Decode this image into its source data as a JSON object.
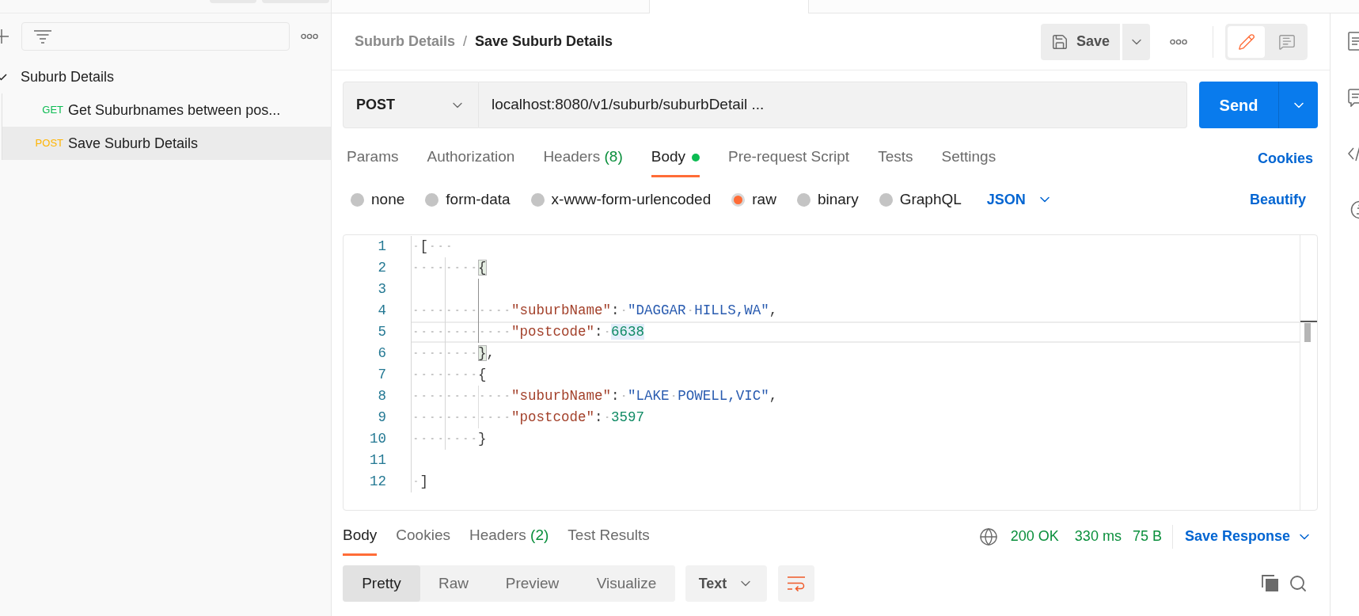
{
  "sidebar": {
    "collection": {
      "name": "Suburb Details",
      "expanded": true,
      "requests": [
        {
          "method": "GET",
          "color": "#0cbb52",
          "name": "Get Suburbnames between pos...",
          "selected": false
        },
        {
          "method": "POST",
          "color": "#ffb400",
          "name": "Save Suburb Details",
          "selected": true
        }
      ]
    }
  },
  "request_tabs": [
    {
      "selected": false
    },
    {
      "selected": false
    },
    {
      "selected": true
    },
    {
      "selected": false
    },
    {
      "selected": false
    },
    {
      "selected": false
    }
  ],
  "breadcrumb": {
    "parent": "Suburb Details",
    "separator": "/",
    "current": "Save Suburb Details"
  },
  "header_actions": {
    "save": "Save",
    "view_modes": [
      {
        "kind": "edit",
        "selected": true
      },
      {
        "kind": "comments",
        "selected": false
      }
    ]
  },
  "request": {
    "method": "POST",
    "url": "localhost:8080/v1/suburb/suburbDetail ...",
    "send": "Send"
  },
  "config_tabs": [
    {
      "label": "Params",
      "selected": false,
      "dot": false
    },
    {
      "label": "Authorization",
      "selected": false,
      "dot": false
    },
    {
      "label": "Headers",
      "count": "(8)",
      "selected": false,
      "dot": false
    },
    {
      "label": "Body",
      "selected": true,
      "dot": true
    },
    {
      "label": "Pre-request Script",
      "selected": false,
      "dot": false
    },
    {
      "label": "Tests",
      "selected": false,
      "dot": false
    },
    {
      "label": "Settings",
      "selected": false,
      "dot": false
    }
  ],
  "cookies": "Cookies",
  "body_types": [
    {
      "label": "none",
      "selected": false
    },
    {
      "label": "form-data",
      "selected": false
    },
    {
      "label": "x-www-form-urlencoded",
      "selected": false
    },
    {
      "label": "raw",
      "selected": true
    },
    {
      "label": "binary",
      "selected": false
    },
    {
      "label": "GraphQL",
      "selected": false
    }
  ],
  "body_format": "JSON",
  "beautify": "Beautify",
  "editor": {
    "lines": [
      {
        "number": "1",
        "current": false,
        "tokens": [
          {
            "kind": "plain",
            "text": " [   "
          }
        ]
      },
      {
        "number": "2",
        "current": false,
        "tokens": [
          {
            "kind": "bracket_match",
            "text": "        {"
          }
        ]
      },
      {
        "number": "3",
        "current": false
      },
      {
        "number": "4",
        "current": false,
        "tokens": [
          {
            "kind": "key",
            "text": "            \"suburbName\""
          },
          {
            "kind": "plain",
            "text": ": "
          },
          {
            "kind": "string",
            "text": "\"DAGGAR HILLS,WA\""
          },
          {
            "kind": "plain",
            "text": ","
          }
        ]
      },
      {
        "number": "5",
        "current": true,
        "tokens": [
          {
            "kind": "key",
            "text": "            \"postcode\""
          },
          {
            "kind": "plain",
            "text": ": "
          },
          {
            "kind": "number_match",
            "text": "6638"
          }
        ]
      },
      {
        "number": "6",
        "current": false,
        "tokens": [
          {
            "kind": "bracket_match",
            "text": "        }"
          },
          {
            "kind": "plain",
            "text": ","
          }
        ]
      },
      {
        "number": "7",
        "current": false,
        "tokens": [
          {
            "kind": "plain",
            "text": "        {"
          }
        ]
      },
      {
        "number": "8",
        "current": false,
        "tokens": [
          {
            "kind": "key",
            "text": "            \"suburbName\""
          },
          {
            "kind": "plain",
            "text": ": "
          },
          {
            "kind": "string",
            "text": "\"LAKE POWELL,VIC\""
          },
          {
            "kind": "plain",
            "text": ","
          }
        ]
      },
      {
        "number": "9",
        "current": false,
        "tokens": [
          {
            "kind": "key",
            "text": "            \"postcode\""
          },
          {
            "kind": "plain",
            "text": ": "
          },
          {
            "kind": "number",
            "text": "3597"
          }
        ]
      },
      {
        "number": "10",
        "current": false,
        "tokens": [
          {
            "kind": "plain",
            "text": "        }"
          }
        ]
      },
      {
        "number": "11",
        "current": false
      },
      {
        "number": "12",
        "current": false,
        "tokens": [
          {
            "kind": "plain",
            "text": " ]"
          }
        ]
      }
    ]
  },
  "response": {
    "tabs": [
      {
        "label": "Body",
        "selected": true
      },
      {
        "label": "Cookies",
        "selected": false
      },
      {
        "label": "Headers",
        "count": "(2)",
        "selected": false
      },
      {
        "label": "Test Results",
        "selected": false
      }
    ],
    "status": "200 OK",
    "time": "330 ms",
    "size": "75 B",
    "save_response": "Save Response",
    "views": [
      {
        "label": "Pretty",
        "selected": true
      },
      {
        "label": "Raw",
        "selected": false
      },
      {
        "label": "Preview",
        "selected": false
      },
      {
        "label": "Visualize",
        "selected": false
      }
    ],
    "format": "Text",
    "wrap_lines": true
  }
}
